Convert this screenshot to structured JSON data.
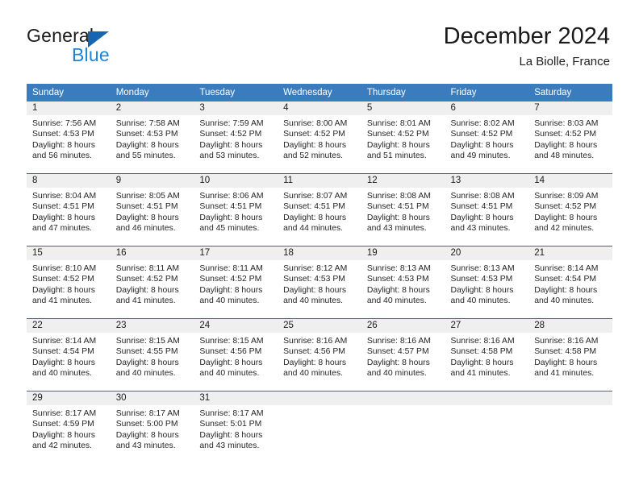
{
  "brand": {
    "name_part1": "General",
    "name_part2": "Blue",
    "triangle_color": "#1565b0",
    "blue_text_color": "#2082d4"
  },
  "header": {
    "title": "December 2024",
    "subtitle": "La Biolle, France"
  },
  "theme": {
    "header_row_bg": "#3a7cbe",
    "week_divider": "#2d6ca8",
    "daynum_band_bg": "#efefef",
    "text_color": "#262626"
  },
  "calendar": {
    "weekday_headers": [
      "Sunday",
      "Monday",
      "Tuesday",
      "Wednesday",
      "Thursday",
      "Friday",
      "Saturday"
    ],
    "weeks": [
      [
        {
          "day": "1",
          "sunrise": "Sunrise: 7:56 AM",
          "sunset": "Sunset: 4:53 PM",
          "daylight_line1": "Daylight: 8 hours",
          "daylight_line2": "and 56 minutes."
        },
        {
          "day": "2",
          "sunrise": "Sunrise: 7:58 AM",
          "sunset": "Sunset: 4:53 PM",
          "daylight_line1": "Daylight: 8 hours",
          "daylight_line2": "and 55 minutes."
        },
        {
          "day": "3",
          "sunrise": "Sunrise: 7:59 AM",
          "sunset": "Sunset: 4:52 PM",
          "daylight_line1": "Daylight: 8 hours",
          "daylight_line2": "and 53 minutes."
        },
        {
          "day": "4",
          "sunrise": "Sunrise: 8:00 AM",
          "sunset": "Sunset: 4:52 PM",
          "daylight_line1": "Daylight: 8 hours",
          "daylight_line2": "and 52 minutes."
        },
        {
          "day": "5",
          "sunrise": "Sunrise: 8:01 AM",
          "sunset": "Sunset: 4:52 PM",
          "daylight_line1": "Daylight: 8 hours",
          "daylight_line2": "and 51 minutes."
        },
        {
          "day": "6",
          "sunrise": "Sunrise: 8:02 AM",
          "sunset": "Sunset: 4:52 PM",
          "daylight_line1": "Daylight: 8 hours",
          "daylight_line2": "and 49 minutes."
        },
        {
          "day": "7",
          "sunrise": "Sunrise: 8:03 AM",
          "sunset": "Sunset: 4:52 PM",
          "daylight_line1": "Daylight: 8 hours",
          "daylight_line2": "and 48 minutes."
        }
      ],
      [
        {
          "day": "8",
          "sunrise": "Sunrise: 8:04 AM",
          "sunset": "Sunset: 4:51 PM",
          "daylight_line1": "Daylight: 8 hours",
          "daylight_line2": "and 47 minutes."
        },
        {
          "day": "9",
          "sunrise": "Sunrise: 8:05 AM",
          "sunset": "Sunset: 4:51 PM",
          "daylight_line1": "Daylight: 8 hours",
          "daylight_line2": "and 46 minutes."
        },
        {
          "day": "10",
          "sunrise": "Sunrise: 8:06 AM",
          "sunset": "Sunset: 4:51 PM",
          "daylight_line1": "Daylight: 8 hours",
          "daylight_line2": "and 45 minutes."
        },
        {
          "day": "11",
          "sunrise": "Sunrise: 8:07 AM",
          "sunset": "Sunset: 4:51 PM",
          "daylight_line1": "Daylight: 8 hours",
          "daylight_line2": "and 44 minutes."
        },
        {
          "day": "12",
          "sunrise": "Sunrise: 8:08 AM",
          "sunset": "Sunset: 4:51 PM",
          "daylight_line1": "Daylight: 8 hours",
          "daylight_line2": "and 43 minutes."
        },
        {
          "day": "13",
          "sunrise": "Sunrise: 8:08 AM",
          "sunset": "Sunset: 4:51 PM",
          "daylight_line1": "Daylight: 8 hours",
          "daylight_line2": "and 43 minutes."
        },
        {
          "day": "14",
          "sunrise": "Sunrise: 8:09 AM",
          "sunset": "Sunset: 4:52 PM",
          "daylight_line1": "Daylight: 8 hours",
          "daylight_line2": "and 42 minutes."
        }
      ],
      [
        {
          "day": "15",
          "sunrise": "Sunrise: 8:10 AM",
          "sunset": "Sunset: 4:52 PM",
          "daylight_line1": "Daylight: 8 hours",
          "daylight_line2": "and 41 minutes."
        },
        {
          "day": "16",
          "sunrise": "Sunrise: 8:11 AM",
          "sunset": "Sunset: 4:52 PM",
          "daylight_line1": "Daylight: 8 hours",
          "daylight_line2": "and 41 minutes."
        },
        {
          "day": "17",
          "sunrise": "Sunrise: 8:11 AM",
          "sunset": "Sunset: 4:52 PM",
          "daylight_line1": "Daylight: 8 hours",
          "daylight_line2": "and 40 minutes."
        },
        {
          "day": "18",
          "sunrise": "Sunrise: 8:12 AM",
          "sunset": "Sunset: 4:53 PM",
          "daylight_line1": "Daylight: 8 hours",
          "daylight_line2": "and 40 minutes."
        },
        {
          "day": "19",
          "sunrise": "Sunrise: 8:13 AM",
          "sunset": "Sunset: 4:53 PM",
          "daylight_line1": "Daylight: 8 hours",
          "daylight_line2": "and 40 minutes."
        },
        {
          "day": "20",
          "sunrise": "Sunrise: 8:13 AM",
          "sunset": "Sunset: 4:53 PM",
          "daylight_line1": "Daylight: 8 hours",
          "daylight_line2": "and 40 minutes."
        },
        {
          "day": "21",
          "sunrise": "Sunrise: 8:14 AM",
          "sunset": "Sunset: 4:54 PM",
          "daylight_line1": "Daylight: 8 hours",
          "daylight_line2": "and 40 minutes."
        }
      ],
      [
        {
          "day": "22",
          "sunrise": "Sunrise: 8:14 AM",
          "sunset": "Sunset: 4:54 PM",
          "daylight_line1": "Daylight: 8 hours",
          "daylight_line2": "and 40 minutes."
        },
        {
          "day": "23",
          "sunrise": "Sunrise: 8:15 AM",
          "sunset": "Sunset: 4:55 PM",
          "daylight_line1": "Daylight: 8 hours",
          "daylight_line2": "and 40 minutes."
        },
        {
          "day": "24",
          "sunrise": "Sunrise: 8:15 AM",
          "sunset": "Sunset: 4:56 PM",
          "daylight_line1": "Daylight: 8 hours",
          "daylight_line2": "and 40 minutes."
        },
        {
          "day": "25",
          "sunrise": "Sunrise: 8:16 AM",
          "sunset": "Sunset: 4:56 PM",
          "daylight_line1": "Daylight: 8 hours",
          "daylight_line2": "and 40 minutes."
        },
        {
          "day": "26",
          "sunrise": "Sunrise: 8:16 AM",
          "sunset": "Sunset: 4:57 PM",
          "daylight_line1": "Daylight: 8 hours",
          "daylight_line2": "and 40 minutes."
        },
        {
          "day": "27",
          "sunrise": "Sunrise: 8:16 AM",
          "sunset": "Sunset: 4:58 PM",
          "daylight_line1": "Daylight: 8 hours",
          "daylight_line2": "and 41 minutes."
        },
        {
          "day": "28",
          "sunrise": "Sunrise: 8:16 AM",
          "sunset": "Sunset: 4:58 PM",
          "daylight_line1": "Daylight: 8 hours",
          "daylight_line2": "and 41 minutes."
        }
      ],
      [
        {
          "day": "29",
          "sunrise": "Sunrise: 8:17 AM",
          "sunset": "Sunset: 4:59 PM",
          "daylight_line1": "Daylight: 8 hours",
          "daylight_line2": "and 42 minutes."
        },
        {
          "day": "30",
          "sunrise": "Sunrise: 8:17 AM",
          "sunset": "Sunset: 5:00 PM",
          "daylight_line1": "Daylight: 8 hours",
          "daylight_line2": "and 43 minutes."
        },
        {
          "day": "31",
          "sunrise": "Sunrise: 8:17 AM",
          "sunset": "Sunset: 5:01 PM",
          "daylight_line1": "Daylight: 8 hours",
          "daylight_line2": "and 43 minutes."
        },
        {
          "day": "",
          "sunrise": "",
          "sunset": "",
          "daylight_line1": "",
          "daylight_line2": ""
        },
        {
          "day": "",
          "sunrise": "",
          "sunset": "",
          "daylight_line1": "",
          "daylight_line2": ""
        },
        {
          "day": "",
          "sunrise": "",
          "sunset": "",
          "daylight_line1": "",
          "daylight_line2": ""
        },
        {
          "day": "",
          "sunrise": "",
          "sunset": "",
          "daylight_line1": "",
          "daylight_line2": ""
        }
      ]
    ]
  }
}
